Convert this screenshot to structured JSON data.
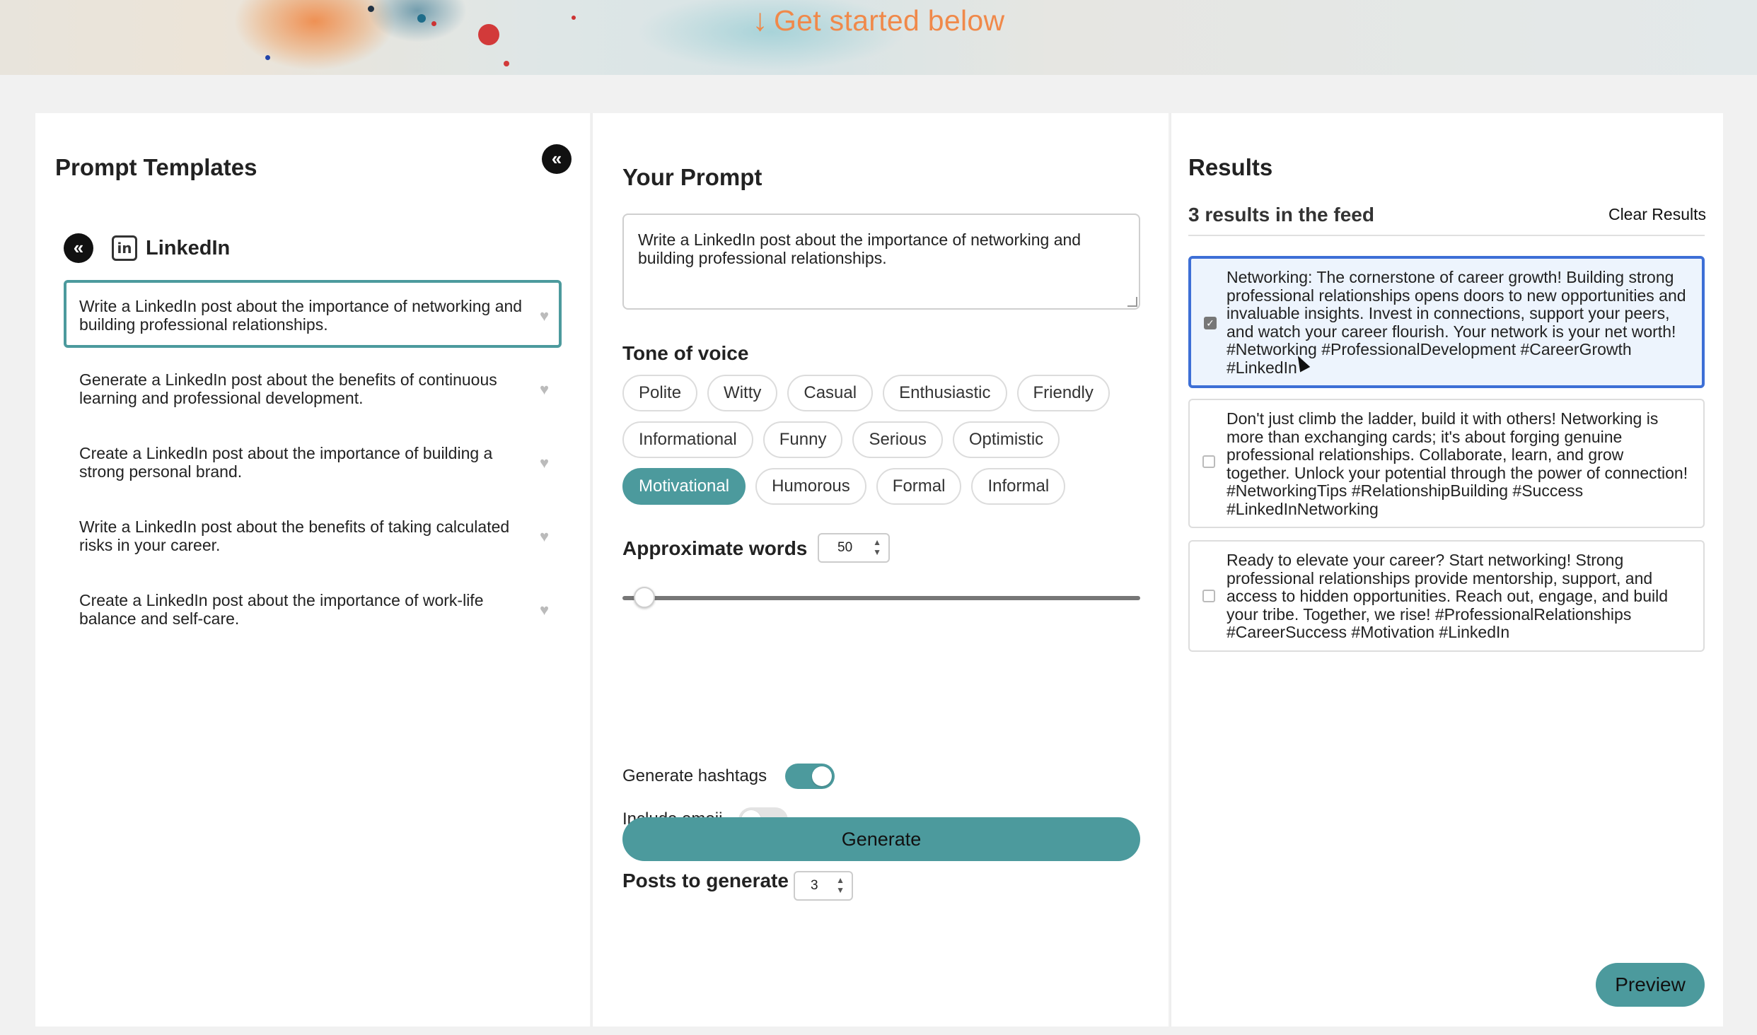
{
  "hero": {
    "cta": "Get started below",
    "arrow_icon": "arrow-down-icon"
  },
  "templates": {
    "title": "Prompt Templates",
    "collapse_icon": "«",
    "category": {
      "back_icon": "«",
      "icon": "linkedin-icon",
      "icon_glyph": "in",
      "label": "LinkedIn"
    },
    "items": [
      {
        "text": "Write a LinkedIn post about the importance of networking and building professional relationships.",
        "active": true
      },
      {
        "text": "Generate a LinkedIn post about the benefits of continuous learning and professional development.",
        "active": false
      },
      {
        "text": "Create a LinkedIn post about the importance of building a strong personal brand.",
        "active": false
      },
      {
        "text": "Write a LinkedIn post about the benefits of taking calculated risks in your career.",
        "active": false
      },
      {
        "text": "Create a LinkedIn post about the importance of work-life balance and self-care.",
        "active": false
      }
    ],
    "heart_glyph": "♥"
  },
  "prompt": {
    "title": "Your Prompt",
    "value": "Write a LinkedIn post about the importance of networking and building professional relationships.",
    "tone_label": "Tone of voice",
    "tones": [
      [
        "Polite",
        "Witty",
        "Casual",
        "Enthusiastic",
        "Friendly"
      ],
      [
        "Informational",
        "Funny",
        "Serious",
        "Optimistic"
      ],
      [
        "Motivational",
        "Humorous",
        "Formal",
        "Informal"
      ]
    ],
    "selected_tone": "Motivational",
    "words_label": "Approximate words",
    "words_value": "50",
    "words_slider_fraction": 0.03,
    "hashtags_label": "Generate hashtags",
    "hashtags_on": true,
    "emoji_label": "Include emoji",
    "emoji_on": false,
    "posts_label": "Posts to generate",
    "posts_value": "3",
    "generate_label": "Generate"
  },
  "results": {
    "title": "Results",
    "count_text": "3 results in the feed",
    "clear_label": "Clear Results",
    "items": [
      {
        "text": "Networking: The cornerstone of career growth! Building strong professional relationships opens doors to new opportunities and invaluable insights. Invest in connections, support your peers, and watch your career flourish. Your network is your net worth! #Networking #ProfessionalDevelopment #CareerGrowth #LinkedIn",
        "checked": true
      },
      {
        "text": "Don't just climb the ladder, build it with others! Networking is more than exchanging cards; it's about forging genuine professional relationships. Collaborate, learn, and grow together. Unlock your potential through the power of connection! #NetworkingTips #RelationshipBuilding #Success #LinkedInNetworking",
        "checked": false
      },
      {
        "text": "Ready to elevate your career? Start networking! Strong professional relationships provide mentorship, support, and access to hidden opportunities. Reach out, engage, and build your tribe. Together, we rise! #ProfessionalRelationships #CareerSuccess #Motivation #LinkedIn",
        "checked": false
      }
    ],
    "preview_label": "Preview"
  },
  "colors": {
    "accent": "#4c9a9d",
    "cta": "#f0894a",
    "selected_border": "#3d6fd6"
  }
}
